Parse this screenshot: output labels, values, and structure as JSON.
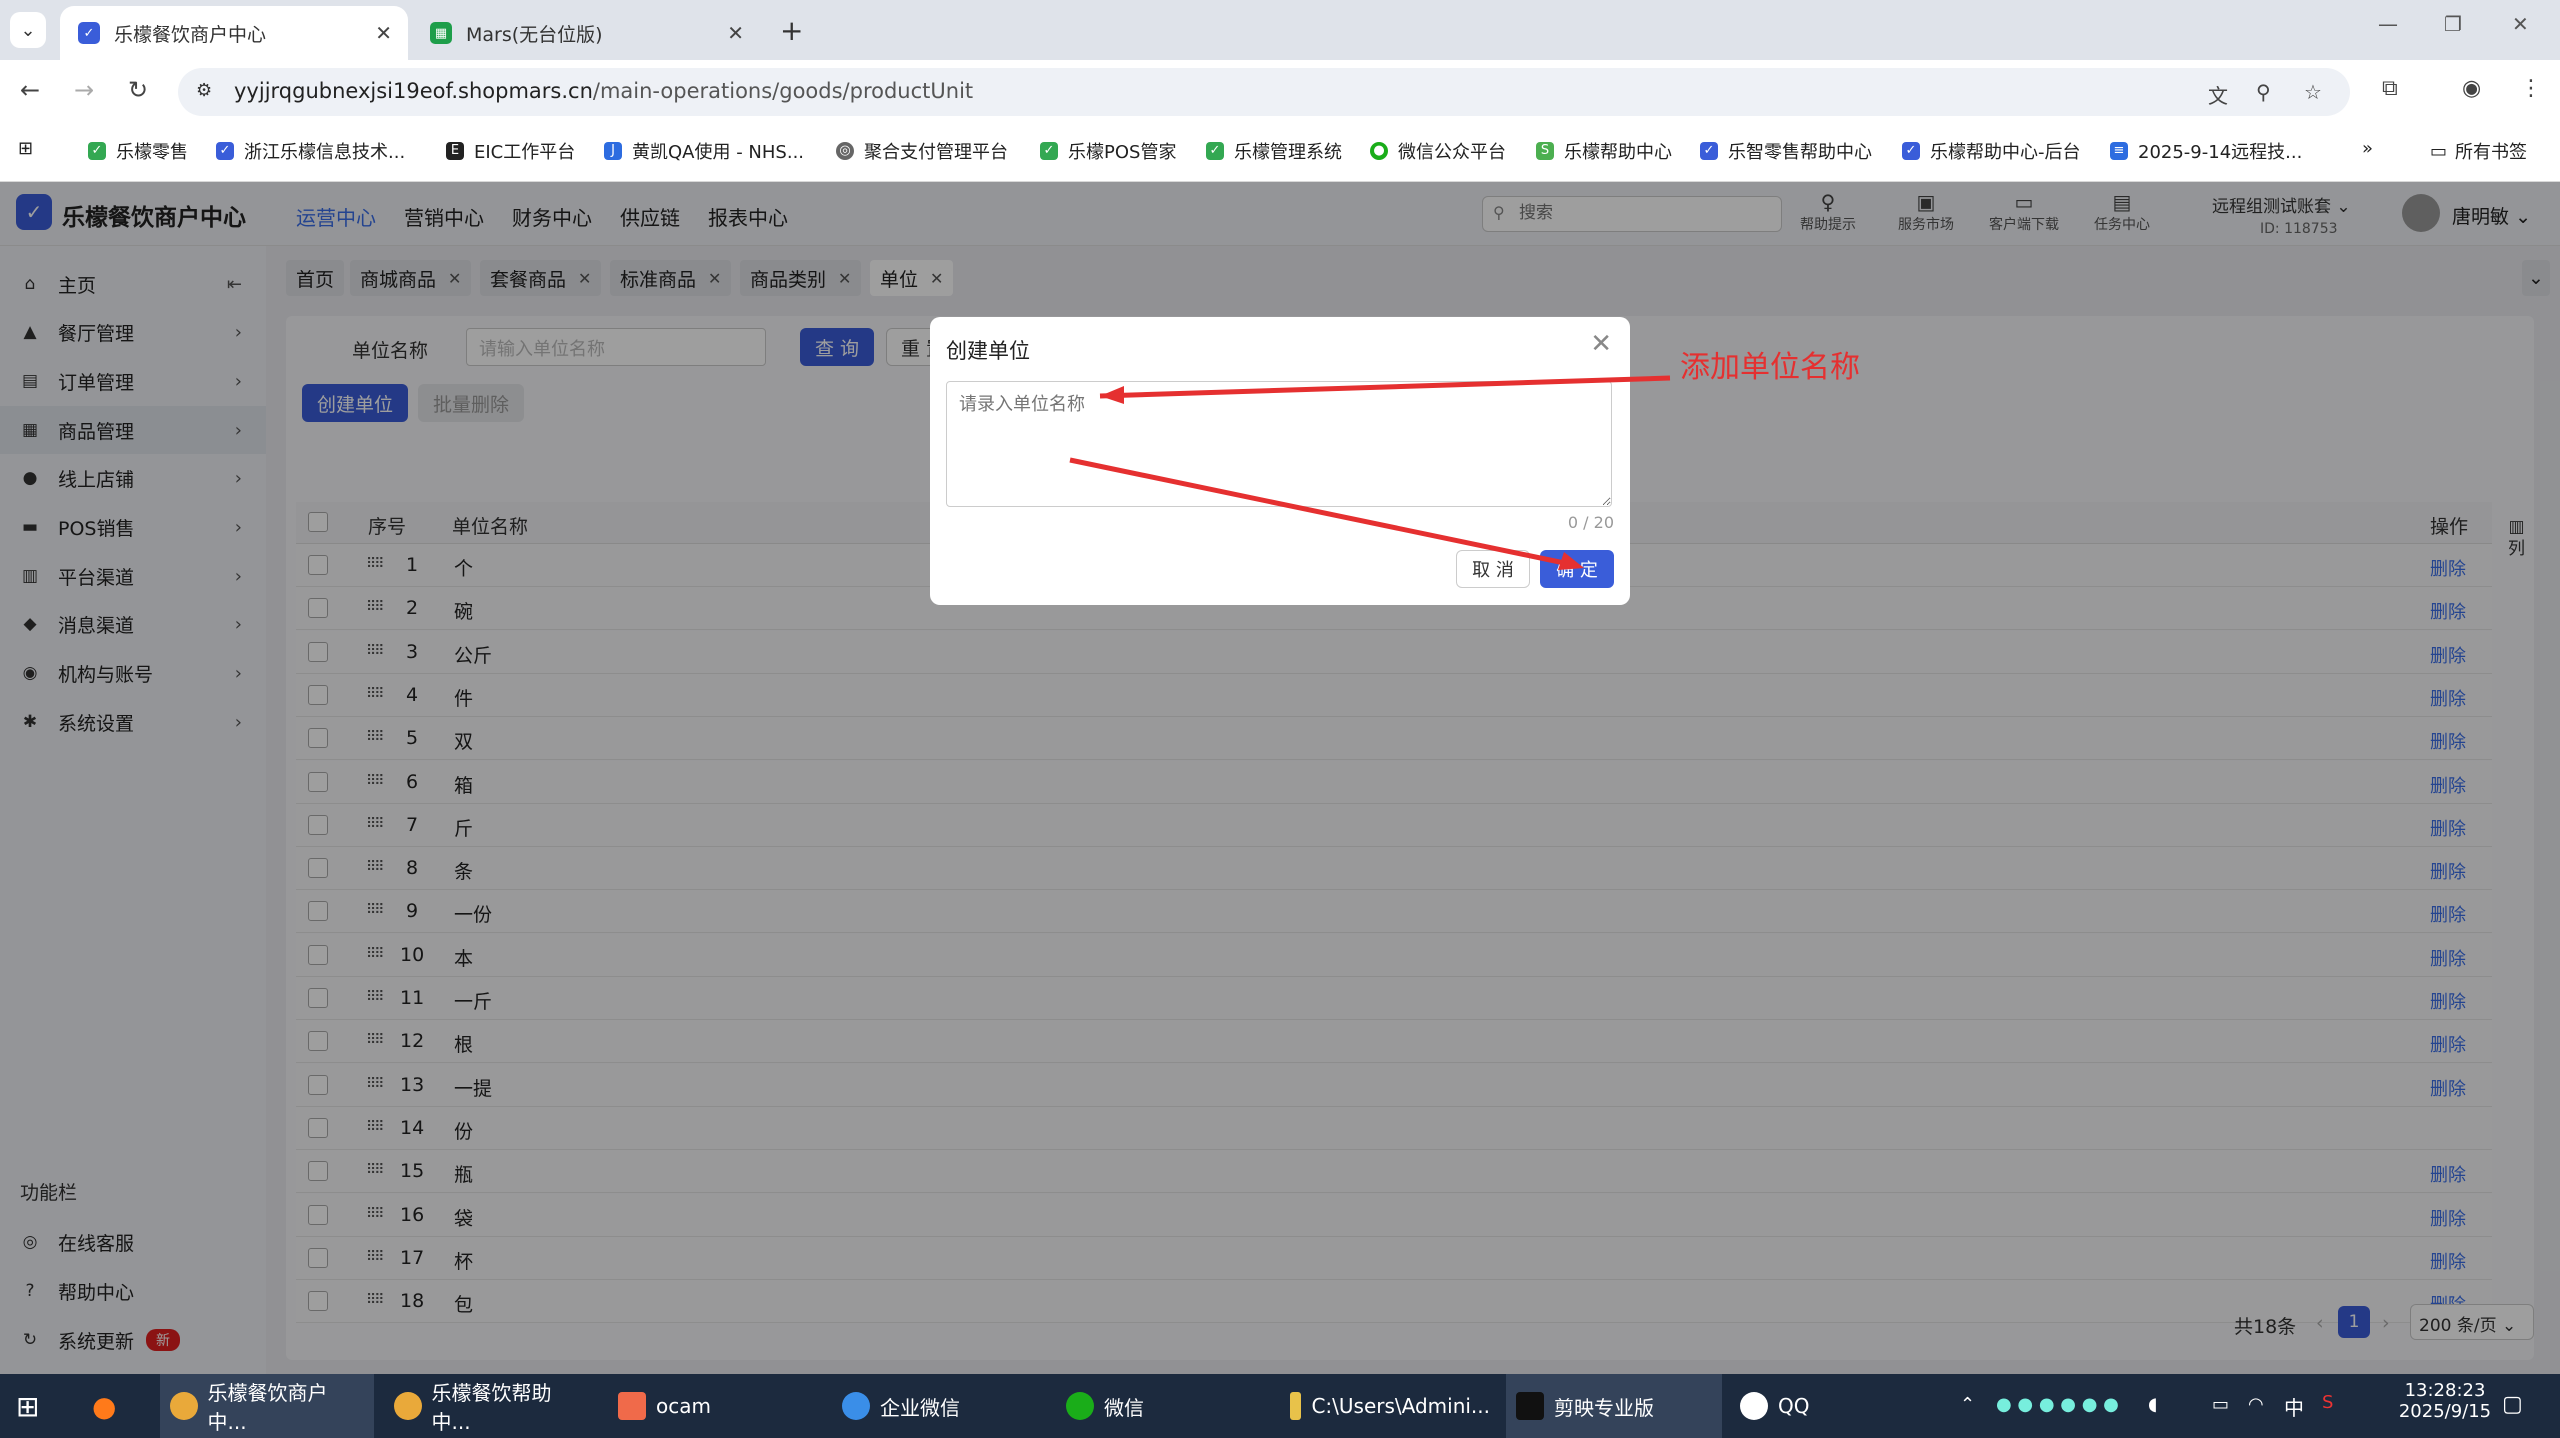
{
  "browser": {
    "tabs": [
      {
        "title": "乐檬餐饮商户中心",
        "active": true,
        "icon": "lemon-app-icon",
        "color": "#3a5dd9"
      },
      {
        "title": "Mars(无台位版)",
        "active": false,
        "icon": "sheets-icon",
        "color": "#1e9e4a"
      }
    ],
    "url_domain": "yyjjrqgubnexjsi19eof.shopmars.cn",
    "url_path": "/main-operations/goods/productUnit",
    "bookmarks": [
      "乐檬零售",
      "浙江乐檬信息技术...",
      "EIC工作平台",
      "黄凯QA使用 - NHS...",
      "聚合支付管理平台",
      "乐檬POS管家",
      "乐檬管理系统",
      "微信公众平台",
      "乐檬帮助中心",
      "乐智零售帮助中心",
      "乐檬帮助中心-后台",
      "2025-9-14远程技..."
    ],
    "bookmarks_all": "所有书签"
  },
  "app": {
    "name": "乐檬餐饮商户中心",
    "nav": [
      "运营中心",
      "营销中心",
      "财务中心",
      "供应链",
      "报表中心"
    ],
    "nav_active": "运营中心",
    "search_placeholder": "搜索",
    "header_icons": [
      {
        "label": "帮助提示",
        "icon": "lightbulb-icon"
      },
      {
        "label": "服务市场",
        "icon": "store-icon"
      },
      {
        "label": "客户端下载",
        "icon": "folder-download-icon"
      },
      {
        "label": "任务中心",
        "icon": "clipboard-icon"
      }
    ],
    "account_name": "远程组测试账套",
    "account_id": "ID: 118753",
    "user_name": "唐明敏"
  },
  "sidebar": {
    "items": [
      {
        "label": "主页",
        "icon": "home-icon"
      },
      {
        "label": "餐厅管理",
        "icon": "restaurant-icon"
      },
      {
        "label": "订单管理",
        "icon": "order-icon"
      },
      {
        "label": "商品管理",
        "icon": "goods-icon",
        "active": true
      },
      {
        "label": "线上店铺",
        "icon": "globe-icon"
      },
      {
        "label": "POS销售",
        "icon": "pos-icon"
      },
      {
        "label": "平台渠道",
        "icon": "bank-icon"
      },
      {
        "label": "消息渠道",
        "icon": "message-icon"
      },
      {
        "label": "机构与账号",
        "icon": "org-icon"
      },
      {
        "label": "系统设置",
        "icon": "gear-icon"
      }
    ],
    "function_header": "功能栏",
    "functions": [
      {
        "label": "在线客服",
        "icon": "headset-icon"
      },
      {
        "label": "帮助中心",
        "icon": "help-icon"
      },
      {
        "label": "系统更新",
        "icon": "refresh-icon",
        "badge": "新"
      }
    ]
  },
  "page_tabs": [
    {
      "label": "首页",
      "closable": false
    },
    {
      "label": "商城商品",
      "closable": true
    },
    {
      "label": "套餐商品",
      "closable": true
    },
    {
      "label": "标准商品",
      "closable": true
    },
    {
      "label": "商品类别",
      "closable": true
    },
    {
      "label": "单位",
      "closable": true,
      "active": true
    }
  ],
  "filter": {
    "label": "单位名称",
    "placeholder": "请输入单位名称",
    "query_button": "查 询",
    "reset_button": "重 置"
  },
  "actions": {
    "create": "创建单位",
    "batch_delete": "批量删除"
  },
  "table": {
    "headers": {
      "index": "序号",
      "name": "单位名称",
      "ops": "操作",
      "columns": "列"
    },
    "delete_label": "删除",
    "rows": [
      {
        "index": "1",
        "name": "个",
        "deletable": true
      },
      {
        "index": "2",
        "name": "碗",
        "deletable": true
      },
      {
        "index": "3",
        "name": "公斤",
        "deletable": true
      },
      {
        "index": "4",
        "name": "件",
        "deletable": true
      },
      {
        "index": "5",
        "name": "双",
        "deletable": true
      },
      {
        "index": "6",
        "name": "箱",
        "deletable": true
      },
      {
        "index": "7",
        "name": "斤",
        "deletable": true
      },
      {
        "index": "8",
        "name": "条",
        "deletable": true
      },
      {
        "index": "9",
        "name": "一份",
        "deletable": true
      },
      {
        "index": "10",
        "name": "本",
        "deletable": true
      },
      {
        "index": "11",
        "name": "一斤",
        "deletable": true
      },
      {
        "index": "12",
        "name": "根",
        "deletable": true
      },
      {
        "index": "13",
        "name": "一提",
        "deletable": true
      },
      {
        "index": "14",
        "name": "份",
        "deletable": false
      },
      {
        "index": "15",
        "name": "瓶",
        "deletable": true
      },
      {
        "index": "16",
        "name": "袋",
        "deletable": true
      },
      {
        "index": "17",
        "name": "杯",
        "deletable": true
      },
      {
        "index": "18",
        "name": "包",
        "deletable": true
      }
    ]
  },
  "pagination": {
    "total": "共18条",
    "current_page": "1",
    "page_size": "200 条/页"
  },
  "modal": {
    "title": "创建单位",
    "placeholder": "请录入单位名称",
    "counter": "0 / 20",
    "cancel": "取 消",
    "confirm": "确 定"
  },
  "annotation": {
    "text": "添加单位名称",
    "color": "#e53030"
  },
  "taskbar": {
    "apps": [
      {
        "label": "乐檬餐饮商户中...",
        "icon": "chrome-icon"
      },
      {
        "label": "乐檬餐饮帮助中...",
        "icon": "chrome-icon"
      },
      {
        "label": "ocam",
        "icon": "ocam-icon"
      },
      {
        "label": "企业微信",
        "icon": "wecom-icon"
      },
      {
        "label": "微信",
        "icon": "wechat-icon"
      },
      {
        "label": "C:\\Users\\Admini...",
        "icon": "folder-icon"
      },
      {
        "label": "剪映专业版",
        "icon": "capcut-icon"
      },
      {
        "label": "QQ",
        "icon": "qq-icon"
      }
    ],
    "ime": "中",
    "time": "13:28:23",
    "date": "2025/9/15"
  }
}
